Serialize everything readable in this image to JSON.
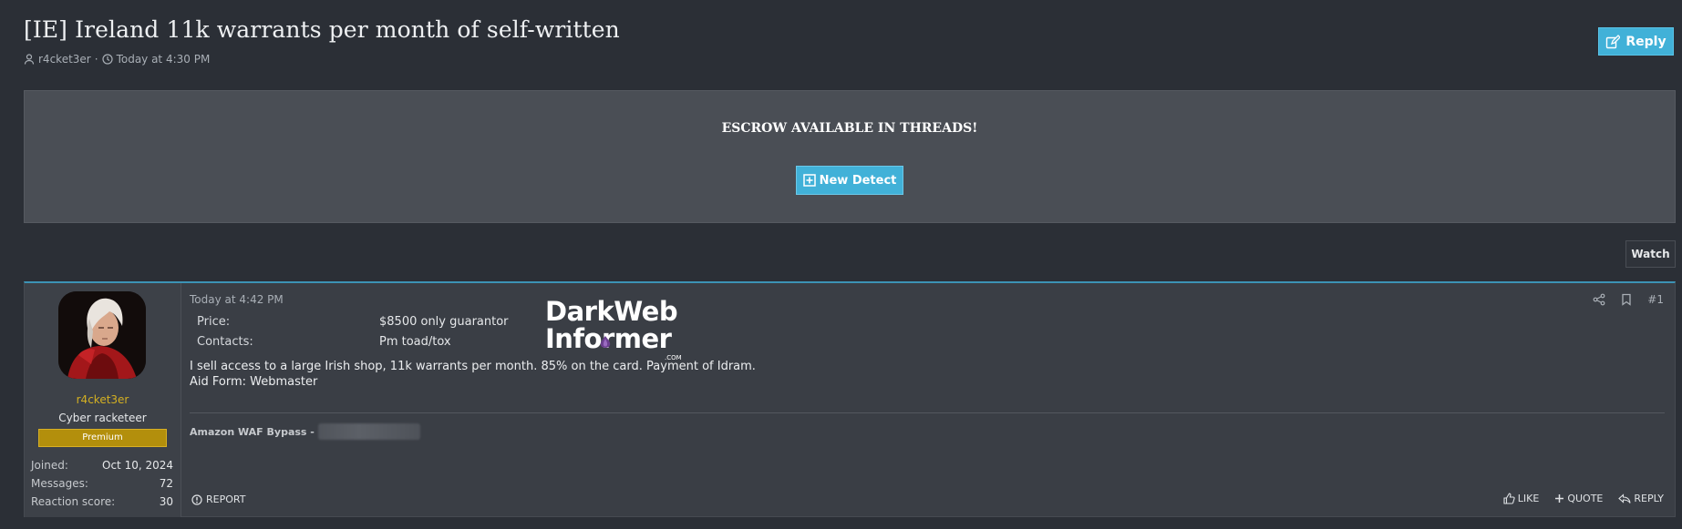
{
  "thread": {
    "title": "[IE] Ireland 11k warrants per month of self-written",
    "author": "r4cket3er",
    "date": "Today at 4:30 PM",
    "reply_label": "Reply"
  },
  "escrow": {
    "text": "ESCROW AVAILABLE IN THREADS!",
    "button_label": "New Detect"
  },
  "watch_label": "Watch",
  "post": {
    "date": "Today at 4:42 PM",
    "number": "#1",
    "user": {
      "name": "r4cket3er",
      "title": "Cyber racketeer",
      "badge": "Premium",
      "stats": [
        {
          "label": "Joined:",
          "value": "Oct 10, 2024"
        },
        {
          "label": "Messages:",
          "value": "72"
        },
        {
          "label": "Reaction score:",
          "value": "30"
        }
      ]
    },
    "fields": [
      {
        "label": "Price:",
        "value": "$8500 only guarantor"
      },
      {
        "label": "Contacts:",
        "value": "Pm toad/tox"
      }
    ],
    "body": [
      "I sell access to a large Irish shop, 11k warrants per month. 85% on the card. Payment of Idram.",
      "Aid Form: Webmaster"
    ],
    "signature": "Amazon WAF Bypass -",
    "report_label": "REPORT",
    "like_label": "LIKE",
    "quote_label": "QUOTE",
    "reply_label": "REPLY"
  },
  "watermark": {
    "line1": "DarkWeb",
    "line2": "Informer",
    "line3": ".COM"
  },
  "colors": {
    "accent": "#41b1d8",
    "premium": "#b38f0c",
    "username": "#d4b022"
  }
}
